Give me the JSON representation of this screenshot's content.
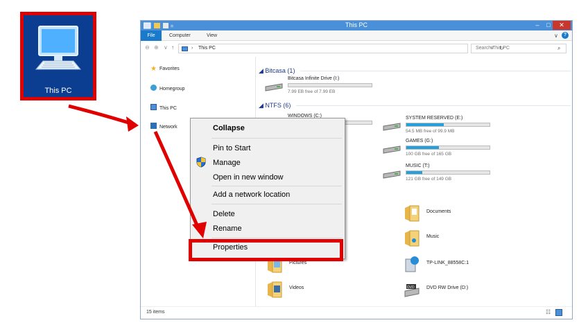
{
  "desktop_icon": {
    "label": "This PC",
    "highlight_color": "#e00000"
  },
  "window": {
    "title": "This PC",
    "controls": {
      "minimize": "–",
      "maximize": "□",
      "close": "✕"
    },
    "ribbon_tabs": [
      "File",
      "Computer",
      "View"
    ],
    "ribbon_expand": "∨",
    "help": "?",
    "nav_buttons": {
      "back": "⊖",
      "forward": "⊕",
      "recent": "∨",
      "up": "↑"
    },
    "address": {
      "separator": "›",
      "path": "This PC",
      "dropdown": "∨",
      "refresh": "↻"
    },
    "search": {
      "placeholder": "Search This PC",
      "icon": "search-icon"
    },
    "nav_pane": [
      {
        "label": "Favorites",
        "icon": "star-icon"
      },
      {
        "label": "Homegroup",
        "icon": "homegroup-icon"
      },
      {
        "label": "This PC",
        "icon": "computer-icon"
      },
      {
        "label": "Network",
        "icon": "network-icon"
      }
    ],
    "groups": [
      {
        "label": "Bitcasa (1)"
      },
      {
        "label": "NTFS (6)"
      }
    ],
    "drives": [
      {
        "name": "Bitcasa Infinite Drive (I:)",
        "free": "7.99 EB free of 7.99 EB",
        "used_fraction": 0.0
      },
      {
        "name": "WINDOWS (C:)",
        "free": "",
        "used_fraction": 0.45
      },
      {
        "name": "SYSTEM RESERVED (E:)",
        "free": "54.5 MB free of 99.9 MB",
        "used_fraction": 0.45
      },
      {
        "name": "GAMES (G:)",
        "free": "100 GB free of 165 GB",
        "used_fraction": 0.39
      },
      {
        "name": "MUSIC (T:)",
        "free": "121 GB free of 149 GB",
        "used_fraction": 0.19
      }
    ],
    "folders": [
      {
        "name": "Documents",
        "icon": "documents-folder-icon"
      },
      {
        "name": "Music",
        "icon": "music-folder-icon"
      },
      {
        "name": "Pictures",
        "icon": "pictures-folder-icon"
      },
      {
        "name": "TP-LINK_88558C:1",
        "icon": "media-device-icon"
      },
      {
        "name": "Videos",
        "icon": "videos-folder-icon"
      },
      {
        "name": "DVD RW Drive (D:)",
        "icon": "dvd-drive-icon"
      }
    ],
    "status": "15 items"
  },
  "context_menu": {
    "items": [
      "Collapse",
      "Pin to Start",
      "Manage",
      "Open in new window",
      "Add a network location",
      "Delete",
      "Rename",
      "Properties"
    ],
    "highlighted": "Properties"
  },
  "colors": {
    "accent": "#1979ca",
    "highlight": "#e00000",
    "drive_bar": "#26a0da"
  }
}
